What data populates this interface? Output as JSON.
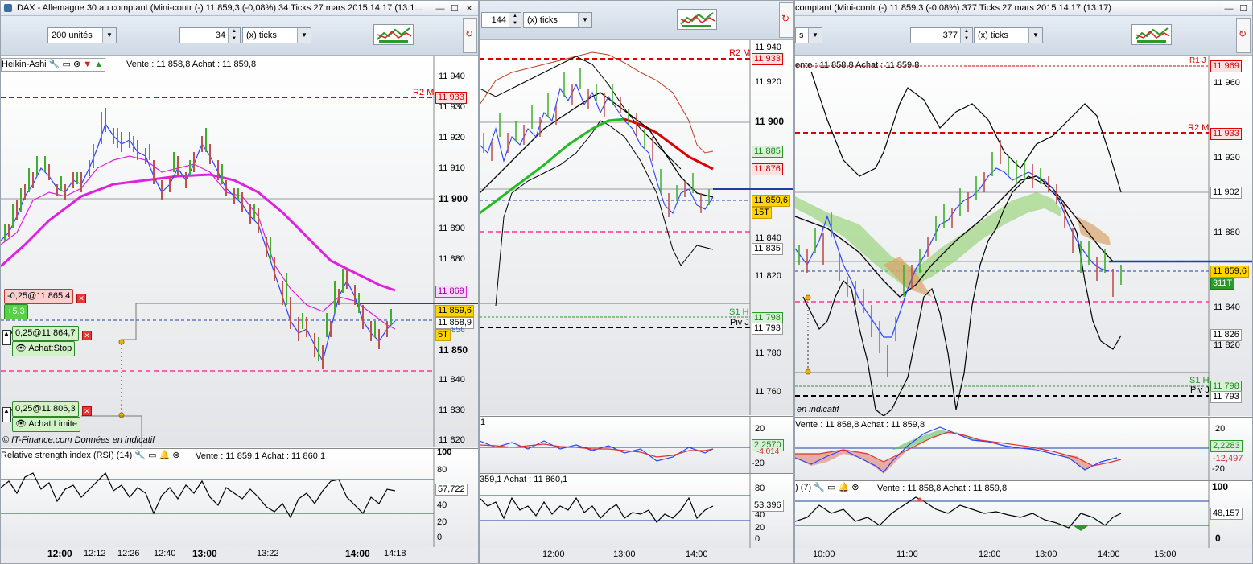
{
  "window1": {
    "title": "DAX - Allemagne 30 au comptant (Mini-contr (-)    11 859,3 (-0,08%)    34 Ticks  27 mars 2015 14:17 (13:1...",
    "units_select": "200 unités",
    "ticks_value": "34",
    "ticks_select": "(x) ticks",
    "indicator_label": "Heikin-Ashi",
    "price_legend": "Vente : 11 858,8 Achat : 11 859,8",
    "y_ticks": [
      "11 940",
      "11 930",
      "11 920",
      "11 910",
      "11 900",
      "11 890",
      "11 880",
      "11 870",
      "11 860",
      "11 850",
      "11 840",
      "11 830",
      "11 820"
    ],
    "r2_label": "R2 M",
    "r2_value": "11 933",
    "box_11869": "11 869",
    "box_last": "11 859,6",
    "box_858": "11 858,9",
    "box_856": "856",
    "box_5t": "5T",
    "order1": "-0,25@11 865,4",
    "order1_pl": "+5,3",
    "order2": "0,25@11 864,7",
    "order2_type": "Achat:Stop",
    "order3": "0,25@11 806,3",
    "order3_type": "Achat:Limite",
    "copyright": "© IT-Finance.com  Données en indicatif",
    "rsi_label": "Relative strength index (RSI) (14)",
    "rsi_legend": "Vente : 11 859,1 Achat : 11 860,1",
    "rsi_ticks": [
      "100",
      "80",
      "60",
      "40",
      "20",
      "0"
    ],
    "rsi_value": "57,722",
    "x_ticks": [
      "12:00",
      "12:12",
      "12:26",
      "12:40",
      "13:00",
      "13:22",
      "14:00",
      "14:18"
    ]
  },
  "window2": {
    "ticks_value": "144",
    "ticks_select": "(x) ticks",
    "y_ticks": [
      "11 940",
      "11 920",
      "11 900",
      "11 880",
      "11 860",
      "11 840",
      "11 820",
      "11 800",
      "11 780",
      "11 760"
    ],
    "r2_label": "R2 M",
    "r2_value": "11 933",
    "box_885": "11 885",
    "box_876": "11 876",
    "box_last": "11 859,6",
    "box_15t": "15T",
    "box_835": "11 835",
    "s1_label": "S1 H",
    "piv_label": "Piv J",
    "box_798": "11 798",
    "box_793": "11 793",
    "macd_ticks": [
      "20",
      "0",
      "-20"
    ],
    "macd_value": "2,2570",
    "macd_value2": "-4,014",
    "macd_small": "1",
    "rsi_legend": "359,1 Achat : 11 860,1",
    "rsi_ticks": [
      "80",
      "60",
      "40",
      "20",
      "0"
    ],
    "rsi_value": "53,396",
    "x_ticks": [
      "12:00",
      "13:00",
      "14:00"
    ]
  },
  "window3": {
    "title": "comptant (Mini-contr (-)    11 859,3 (-0,08%)    377 Ticks  27 mars 2015 14:17 (13:17)",
    "units_select": "s",
    "ticks_value": "377",
    "ticks_select": "(x) ticks",
    "price_legend": "ente : 11 858,8 Achat : 11 859,8",
    "y_ticks": [
      "11 960",
      "11 940",
      "11 920",
      "11 900",
      "11 880",
      "11 860",
      "11 840",
      "11 820"
    ],
    "r1_label": "R1 J",
    "r1_value": "11 969",
    "r2_label": "R2 M",
    "r2_value": "11 933",
    "box_902": "11 902",
    "box_last": "11 859,6",
    "box_311t": "311T",
    "box_826": "11 826",
    "s1_label": "S1 H",
    "piv_label": "Piv J",
    "box_798": "11 798",
    "box_793": "11 793",
    "indicatif": "en indicatif",
    "macd_legend": "Vente : 11 858,8 Achat : 11 859,8",
    "macd_ticks": [
      "20",
      "0",
      "-20"
    ],
    "macd_value": "2,2283",
    "macd_value2": "-12,497",
    "rsi_label": ") (7)",
    "rsi_legend": "Vente : 11 858,8 Achat : 11 859,8",
    "rsi_ticks": [
      "100",
      "50",
      "0"
    ],
    "rsi_value": "48,157",
    "x_ticks": [
      "10:00",
      "11:00",
      "12:00",
      "13:00",
      "14:00",
      "15:00"
    ]
  },
  "colors": {
    "up_candle": "#3fae2b",
    "down_candle": "#c0504d",
    "pivot_red": "#dd0000",
    "pivot_pink": "#ff3399",
    "blue_level": "#1f3ea8",
    "ma_magenta": "#e020e0"
  }
}
